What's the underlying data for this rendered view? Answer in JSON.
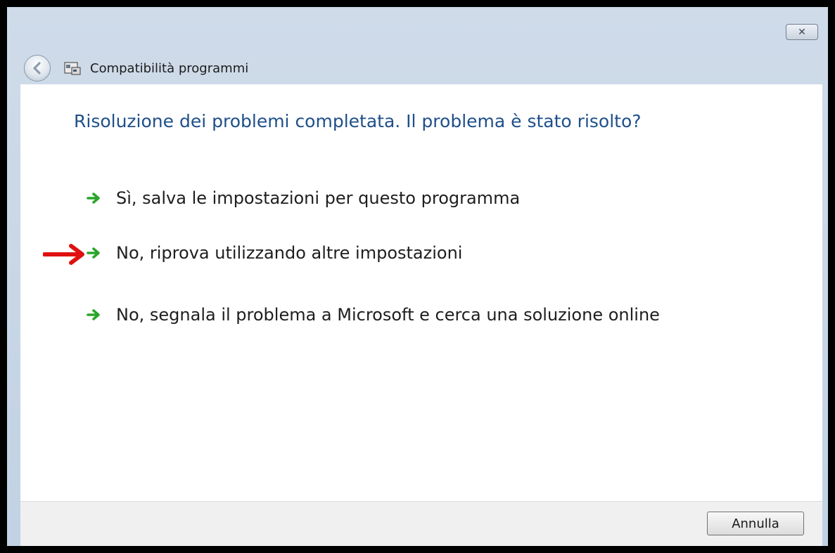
{
  "window": {
    "title": "Compatibilità programmi",
    "close_label": "✕"
  },
  "main": {
    "heading": "Risoluzione dei problemi completata. Il problema è stato risolto?",
    "options": [
      {
        "label": "Sì, salva le impostazioni per questo programma",
        "icon": "green-arrow-icon"
      },
      {
        "label": "No, riprova utilizzando altre impostazioni",
        "icon": "green-arrow-icon"
      },
      {
        "label": "No, segnala il problema a Microsoft e cerca una soluzione online",
        "icon": "green-arrow-icon"
      }
    ],
    "highlight_icon": "red-arrow-icon"
  },
  "footer": {
    "cancel_label": "Annulla"
  },
  "colors": {
    "heading": "#1f4f8a",
    "option_arrow": "#2aa52a",
    "highlight_arrow": "#e01010",
    "chrome": "#c2d2e4",
    "footer_bg": "#f0f0f0"
  }
}
